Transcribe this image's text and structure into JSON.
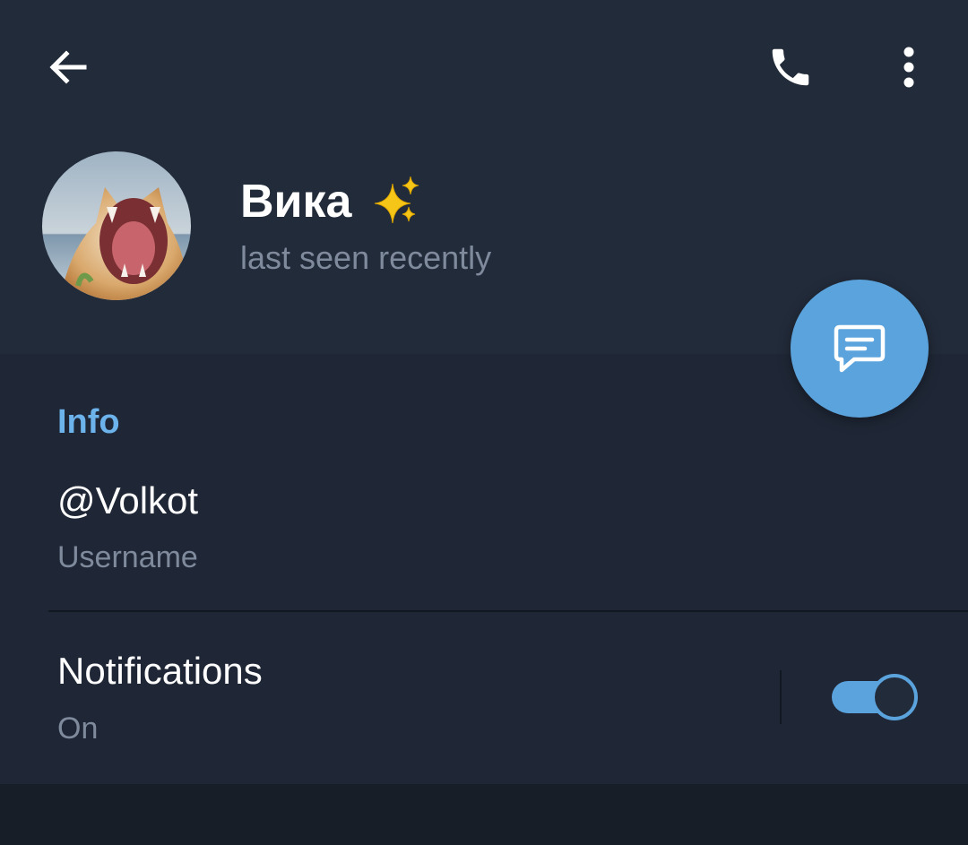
{
  "header": {
    "back_icon": "arrow-left-icon",
    "call_icon": "phone-icon",
    "menu_icon": "more-vertical-icon"
  },
  "profile": {
    "name": "Вика",
    "name_emoji": "sparkles-icon",
    "status": "last seen recently",
    "avatar": "cat-yawning-photo"
  },
  "fab": {
    "icon": "message-icon",
    "color": "#5ba3dd"
  },
  "info": {
    "title": "Info",
    "username": {
      "value": "@Volkot",
      "label": "Username"
    },
    "notifications": {
      "value": "Notifications",
      "label": "On",
      "enabled": true
    }
  },
  "colors": {
    "header_bg": "#222b3a",
    "section_bg": "#1f2736",
    "accent": "#6cb3ec",
    "secondary_text": "#7f8b9d"
  }
}
